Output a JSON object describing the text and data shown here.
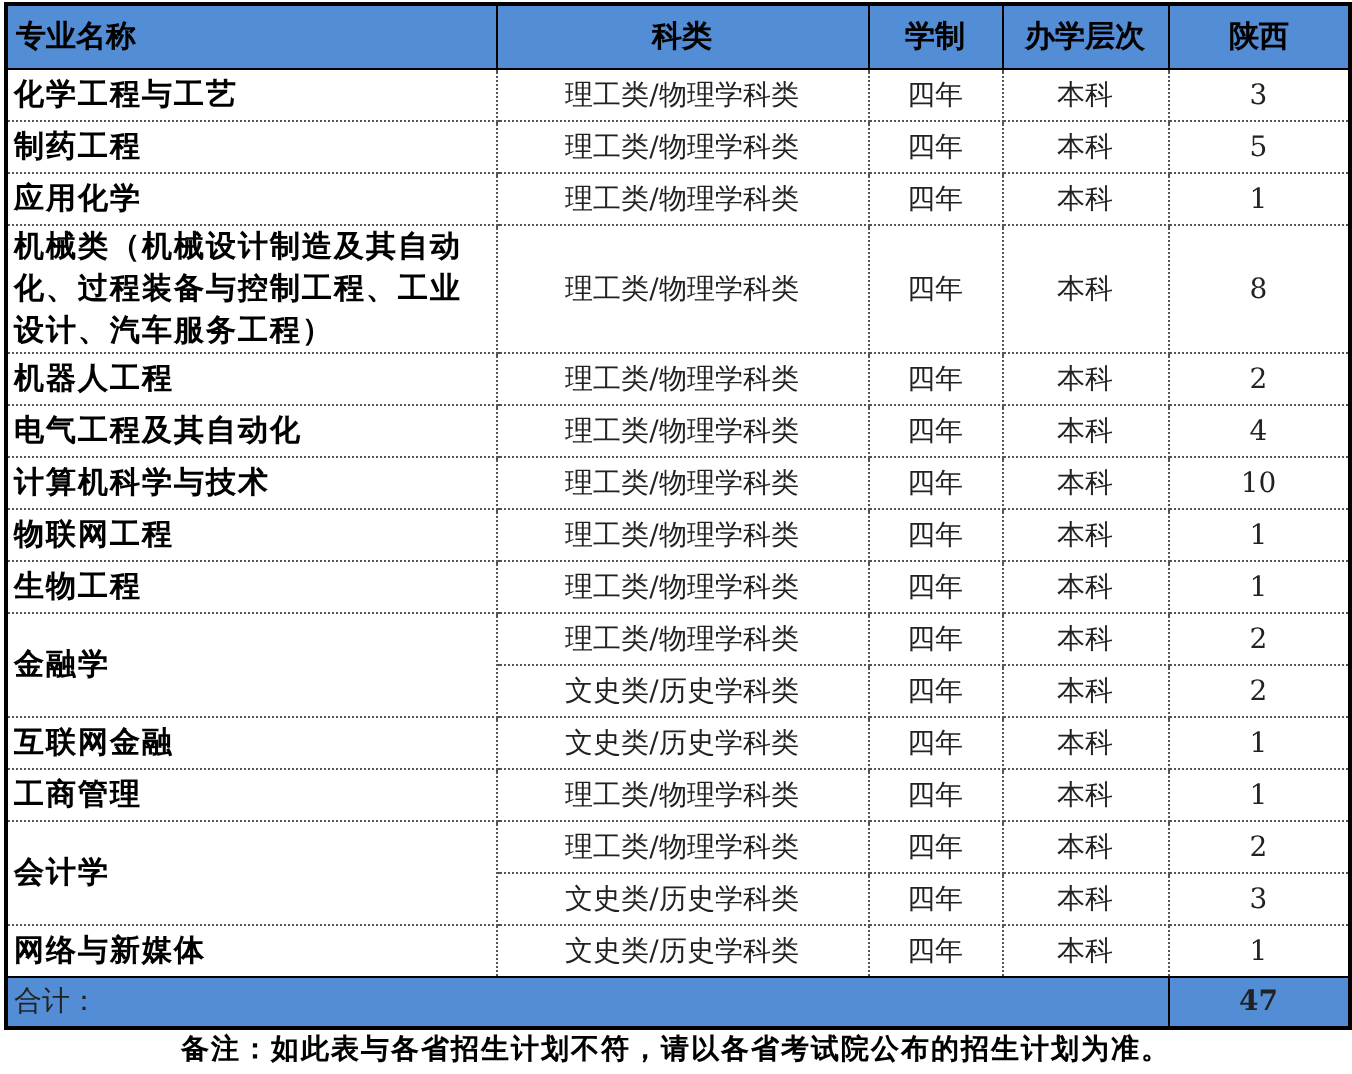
{
  "table": {
    "columns": [
      "专业名称",
      "科类",
      "学制",
      "办学层次",
      "陕西"
    ],
    "rows": [
      {
        "major": "化学工程与工艺",
        "entries": [
          {
            "category": "理工类/物理学科类",
            "duration": "四年",
            "level_of_study": "本科",
            "count": "3"
          }
        ]
      },
      {
        "major": "制药工程",
        "entries": [
          {
            "category": "理工类/物理学科类",
            "duration": "四年",
            "level_of_study": "本科",
            "count": "5"
          }
        ]
      },
      {
        "major": "应用化学",
        "entries": [
          {
            "category": "理工类/物理学科类",
            "duration": "四年",
            "level_of_study": "本科",
            "count": "1"
          }
        ]
      },
      {
        "major": "机械类（机械设计制造及其自动化、过程装备与控制工程、工业设计、汽车服务工程）",
        "entries": [
          {
            "category": "理工类/物理学科类",
            "duration": "四年",
            "level_of_study": "本科",
            "count": "8"
          }
        ]
      },
      {
        "major": "机器人工程",
        "entries": [
          {
            "category": "理工类/物理学科类",
            "duration": "四年",
            "level_of_study": "本科",
            "count": "2"
          }
        ]
      },
      {
        "major": "电气工程及其自动化",
        "entries": [
          {
            "category": "理工类/物理学科类",
            "duration": "四年",
            "level_of_study": "本科",
            "count": "4"
          }
        ]
      },
      {
        "major": "计算机科学与技术",
        "entries": [
          {
            "category": "理工类/物理学科类",
            "duration": "四年",
            "level_of_study": "本科",
            "count": "10"
          }
        ]
      },
      {
        "major": "物联网工程",
        "entries": [
          {
            "category": "理工类/物理学科类",
            "duration": "四年",
            "level_of_study": "本科",
            "count": "1"
          }
        ]
      },
      {
        "major": "生物工程",
        "entries": [
          {
            "category": "理工类/物理学科类",
            "duration": "四年",
            "level_of_study": "本科",
            "count": "1"
          }
        ]
      },
      {
        "major": "金融学",
        "entries": [
          {
            "category": "理工类/物理学科类",
            "duration": "四年",
            "level_of_study": "本科",
            "count": "2"
          },
          {
            "category": "文史类/历史学科类",
            "duration": "四年",
            "level_of_study": "本科",
            "count": "2"
          }
        ]
      },
      {
        "major": "互联网金融",
        "entries": [
          {
            "category": "文史类/历史学科类",
            "duration": "四年",
            "level_of_study": "本科",
            "count": "1"
          }
        ]
      },
      {
        "major": "工商管理",
        "entries": [
          {
            "category": "理工类/物理学科类",
            "duration": "四年",
            "level_of_study": "本科",
            "count": "1"
          }
        ]
      },
      {
        "major": "会计学",
        "entries": [
          {
            "category": "理工类/物理学科类",
            "duration": "四年",
            "level_of_study": "本科",
            "count": "2"
          },
          {
            "category": "文史类/历史学科类",
            "duration": "四年",
            "level_of_study": "本科",
            "count": "3"
          }
        ]
      },
      {
        "major": "网络与新媒体",
        "entries": [
          {
            "category": "文史类/历史学科类",
            "duration": "四年",
            "level_of_study": "本科",
            "count": "1"
          }
        ]
      }
    ],
    "total": {
      "label": "合计：",
      "value": "47"
    }
  },
  "note": "备注：如此表与各省招生计划不符，请以各省考试院公布的招生计划为准。"
}
